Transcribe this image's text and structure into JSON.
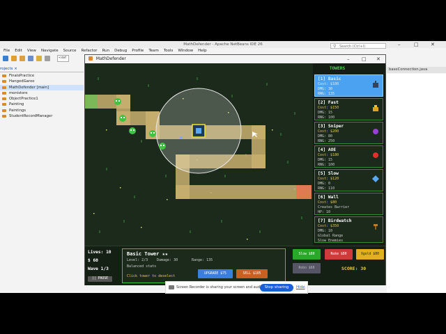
{
  "ide": {
    "title": "MathDefender - Apache NetBeans IDE 26",
    "search_placeholder": "Search (Ctrl+I)",
    "menu": [
      "File",
      "Edit",
      "View",
      "Navigate",
      "Source",
      "Refactor",
      "Run",
      "Debug",
      "Profile",
      "Team",
      "Tools",
      "Window",
      "Help"
    ],
    "toolbar_combo": "<def",
    "projects_tab": "rojects ×",
    "projects": [
      "FinalsPractice",
      "HangedGaroo",
      "MathDefender [main]",
      "monistore",
      "ObjectPractice1",
      "Painting",
      "Paintings",
      "StudentRecordManager"
    ],
    "selected_project_index": 2,
    "editor_tab": "baseConnection.java"
  },
  "game": {
    "window_title": "MathDefender",
    "towers_header": "TOWERS",
    "towers": [
      {
        "name": "[1] Basic",
        "cost": "Cost: $100",
        "dmg": "DMG: 30",
        "extra": "RNG: 135",
        "color": "#4aa2f0",
        "icon_color": "#334455",
        "selected": true
      },
      {
        "name": "[2] Fast",
        "cost": "Cost: $150",
        "dmg": "DMG: 15",
        "extra": "RNG: 100",
        "color": "#3b8a3b",
        "icon_color": "#e0a020",
        "selected": false
      },
      {
        "name": "[3] Sniper",
        "cost": "Cost: $200",
        "dmg": "DMG: 80",
        "extra": "RNG: 250",
        "color": "#3b8a3b",
        "icon_color": "#9a3fd6",
        "selected": false
      },
      {
        "name": "[4] AOE",
        "cost": "Cost: $180",
        "dmg": "DMG: 15",
        "extra": "RNG: 100",
        "color": "#3b8a3b",
        "icon_color": "#e03030",
        "selected": false
      },
      {
        "name": "[5] Slow",
        "cost": "Cost: $120",
        "dmg": "DMG: 0",
        "extra": "RNG: 110",
        "color": "#3b8a3b",
        "icon_color": "#5aa9f0",
        "selected": false
      },
      {
        "name": "[6] Wall",
        "cost": "Cost: $80",
        "dmg": "Creates Barrier",
        "extra": "HP: 10",
        "color": "#3b8a3b",
        "icon_color": "",
        "selected": false
      },
      {
        "name": "[7] Birdwatch",
        "cost": "Cost: $350",
        "dmg": "DMG: 10",
        "extra": "Global Range",
        "extra2": "Slow Enemies",
        "color": "#3b8a3b",
        "icon_color": "#b08030",
        "selected": false
      }
    ],
    "lives": "Lives: 10",
    "money": "$ 60",
    "wave": "Wave 1/3",
    "pause_label": "|| PAUSE",
    "info": {
      "title": "Basic Tower ★★",
      "level": "Level: 2/3",
      "damage": "Damage: 30",
      "range": "Range: 135",
      "desc": "Balanced stats",
      "hint": "Click tower to deselect",
      "upgrade": "UPGRADE $75",
      "sell": "SELL $105"
    },
    "actions": {
      "slow": "Slow $80",
      "nuke": "Nuke $80",
      "gold": "Xgold $80",
      "robo": "Robo $60"
    },
    "score": "SCORE: 30"
  },
  "share_bar": {
    "message": "Screen Recorder is sharing your screen and audio.",
    "stop": "Stop sharing",
    "hide": "Hide"
  },
  "colors": {
    "path": "#c9b070",
    "enemy": "#3ec43e",
    "panel_border": "#3b8a3b",
    "slow_button": "#2aa82a",
    "nuke_button": "#d13a3a",
    "gold_button": "#e0b020",
    "robo_button": "#555566",
    "upgrade_button": "#3a7fe0",
    "sell_button": "#c86020"
  }
}
